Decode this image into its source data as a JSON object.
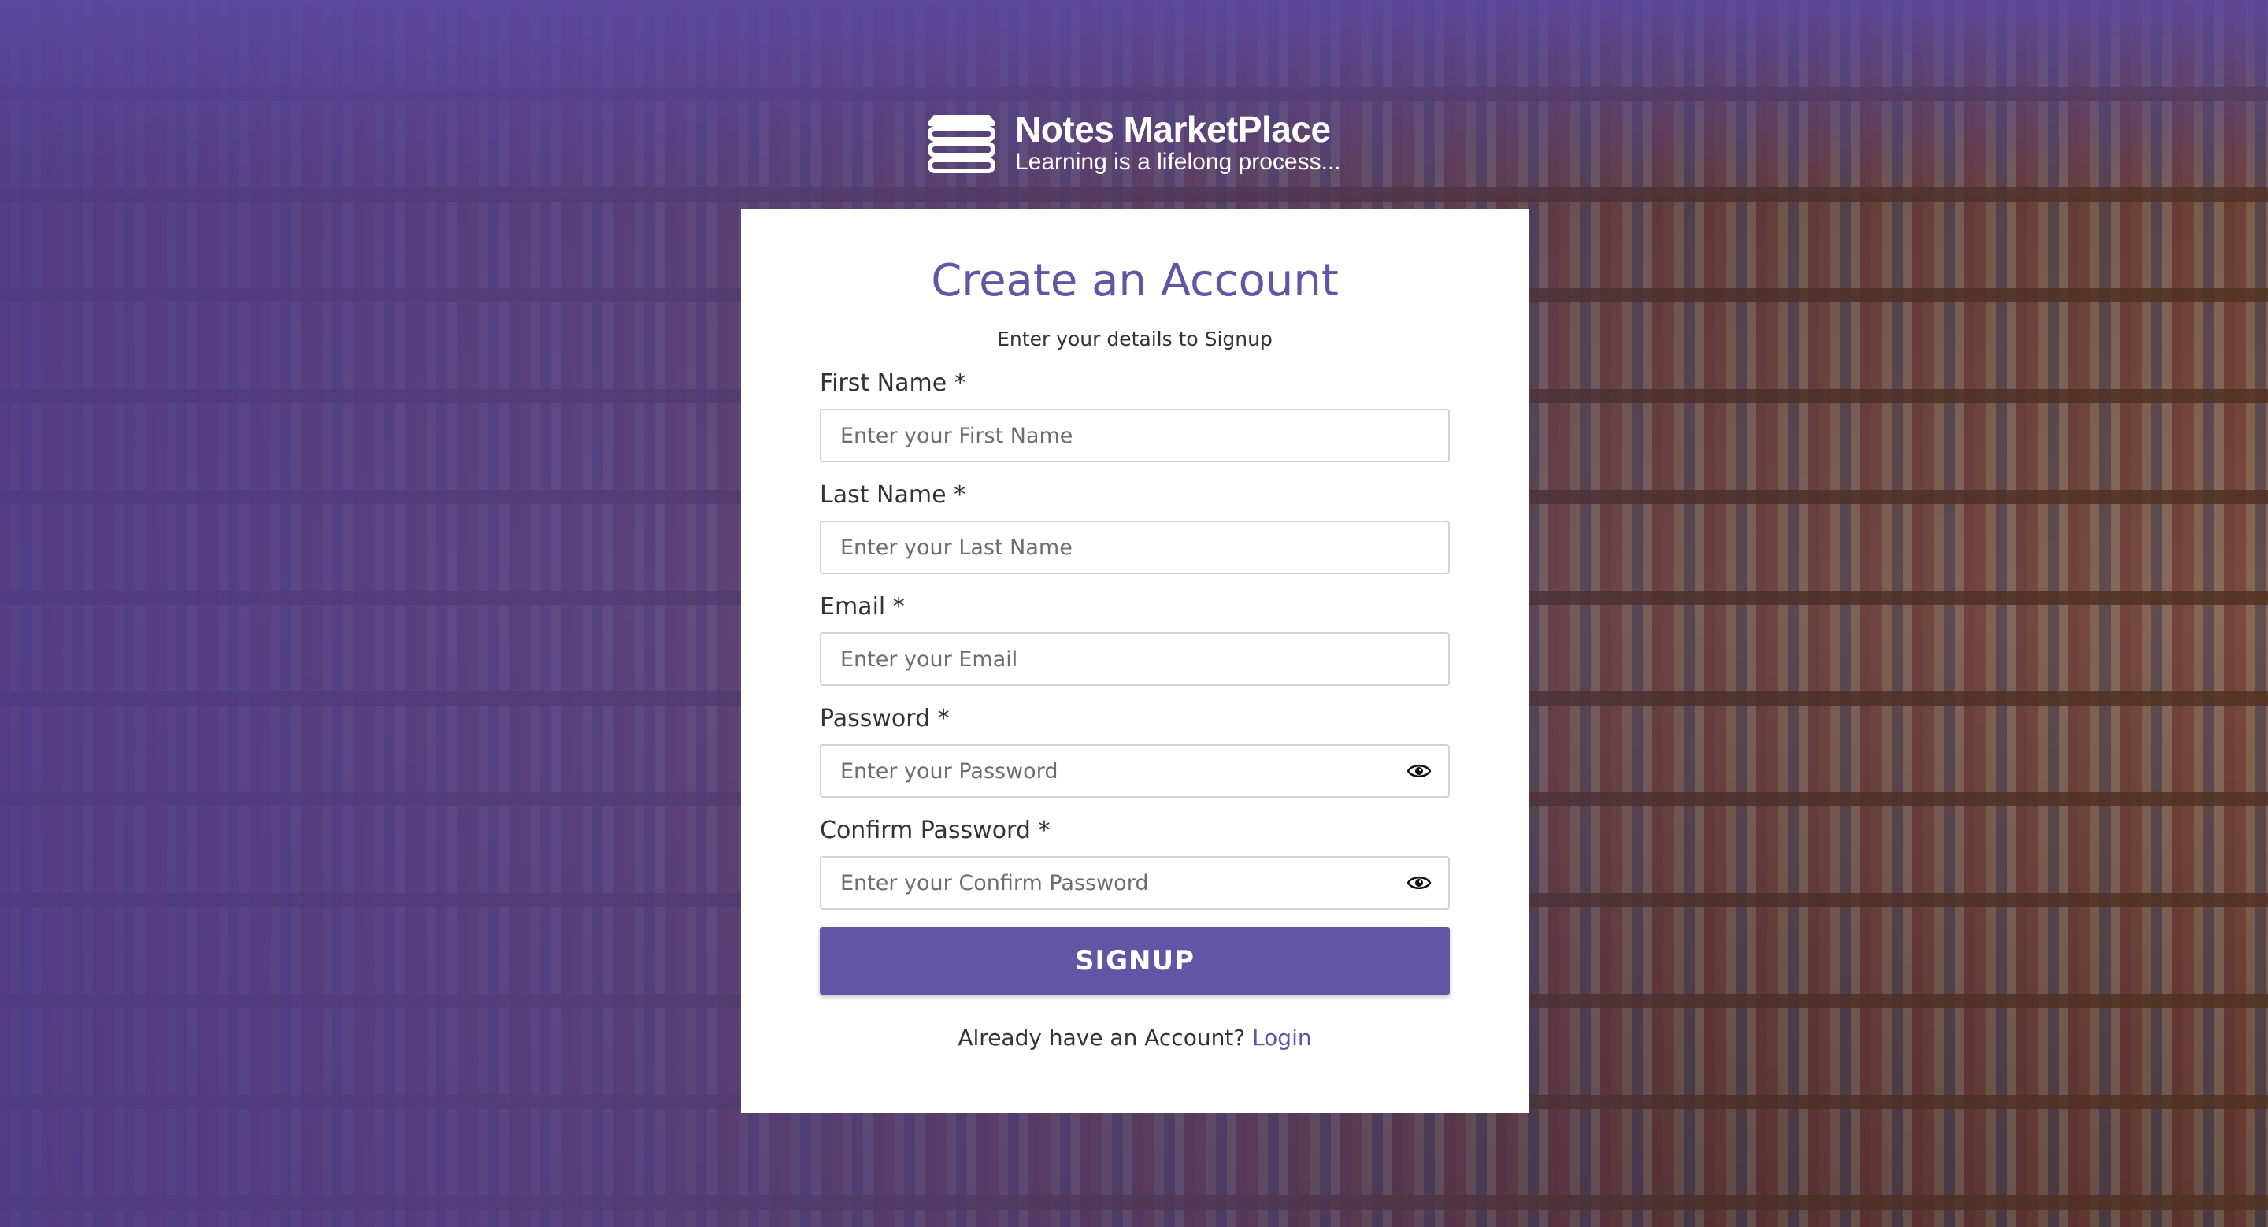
{
  "brand": {
    "name": "Notes MarketPlace",
    "tagline": "Learning is a lifelong process..."
  },
  "form": {
    "title": "Create an Account",
    "subtitle": "Enter your details to Signup",
    "fields": [
      {
        "label": "First Name *",
        "placeholder": "Enter your First Name",
        "type": "text"
      },
      {
        "label": "Last Name *",
        "placeholder": "Enter your Last Name",
        "type": "text"
      },
      {
        "label": "Email *",
        "placeholder": "Enter your Email",
        "type": "email"
      },
      {
        "label": "Password *",
        "placeholder": "Enter your Password",
        "type": "password",
        "icon": "eye-icon"
      },
      {
        "label": "Confirm Password *",
        "placeholder": "Enter your Confirm Password",
        "type": "password",
        "icon": "eye-icon"
      }
    ],
    "submit_label": "SIGNUP",
    "login_prompt": "Already have an Account?",
    "login_link": "Login"
  },
  "colors": {
    "accent": "#6255a5",
    "card": "#ffffff",
    "text": "#333333"
  }
}
